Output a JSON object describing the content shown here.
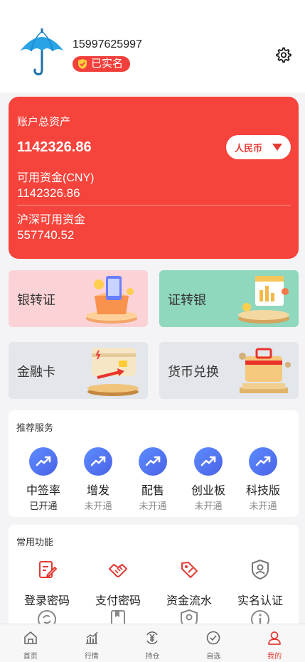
{
  "header": {
    "phone": "15997625997",
    "verified_label": "已实名"
  },
  "asset_card": {
    "total_label": "账户总资产",
    "total_value": "1142326.86",
    "currency_label": "人民币",
    "available_label": "可用资金(CNY)",
    "available_value": "1142326.86",
    "sh_sz_label": "沪深可用资金",
    "sh_sz_value": "557740.52"
  },
  "tiles": [
    {
      "label": "银转证"
    },
    {
      "label": "证转银"
    },
    {
      "label": "金融卡"
    },
    {
      "label": "货币兑换"
    }
  ],
  "recommended": {
    "title": "推荐服务",
    "items": [
      {
        "name": "中签率",
        "status": "已开通"
      },
      {
        "name": "增发",
        "status": "未开通"
      },
      {
        "name": "配售",
        "status": "未开通"
      },
      {
        "name": "创业板",
        "status": "未开通"
      },
      {
        "name": "科技版",
        "status": "未开通"
      }
    ]
  },
  "common": {
    "title": "常用功能",
    "items": [
      {
        "name": "登录密码",
        "icon": "edit-doc-icon"
      },
      {
        "name": "支付密码",
        "icon": "handshake-icon"
      },
      {
        "name": "资金流水",
        "icon": "tag-icon"
      },
      {
        "name": "实名认证",
        "icon": "id-shield-icon"
      }
    ]
  },
  "tabbar": [
    {
      "label": "首页",
      "icon": "home-icon"
    },
    {
      "label": "行情",
      "icon": "chart-icon"
    },
    {
      "label": "持仓",
      "icon": "yuan-icon"
    },
    {
      "label": "自选",
      "icon": "check-circle-icon"
    },
    {
      "label": "我的",
      "icon": "user-icon"
    }
  ],
  "colors": {
    "accent": "#f6433b",
    "tab_active": "#e23b34",
    "service_icon": "#4a62e6"
  }
}
